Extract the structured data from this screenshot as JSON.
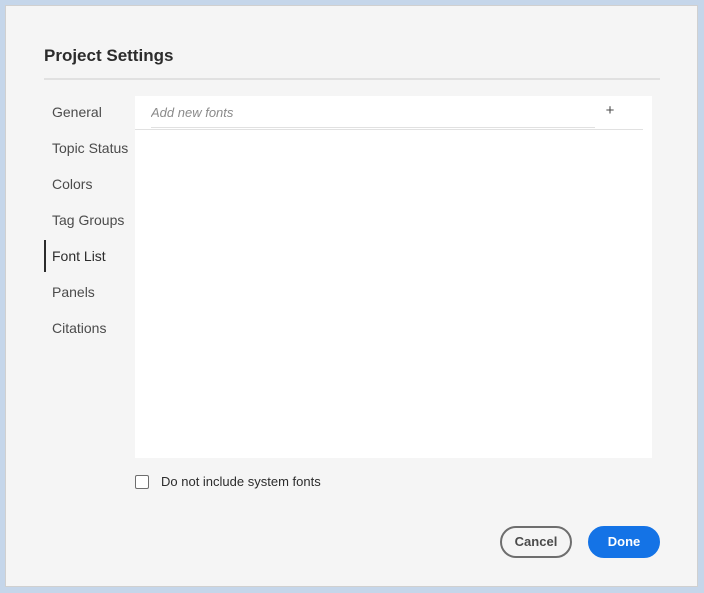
{
  "dialog": {
    "title": "Project Settings"
  },
  "nav": {
    "items": [
      {
        "label": "General"
      },
      {
        "label": "Topic Status"
      },
      {
        "label": "Colors"
      },
      {
        "label": "Tag Groups"
      },
      {
        "label": "Font List",
        "selected": true
      },
      {
        "label": "Panels"
      },
      {
        "label": "Citations"
      }
    ]
  },
  "font_list": {
    "placeholder": "Add new fonts",
    "value": "",
    "add_icon": "plus-icon",
    "add_glyph": "+",
    "fonts": []
  },
  "options": {
    "exclude_system_fonts_label": "Do not include system fonts",
    "exclude_system_fonts_checked": false
  },
  "footer": {
    "cancel_label": "Cancel",
    "done_label": "Done"
  },
  "colors": {
    "accent": "#1473e6",
    "background": "#f5f5f5",
    "panel": "#ffffff"
  }
}
